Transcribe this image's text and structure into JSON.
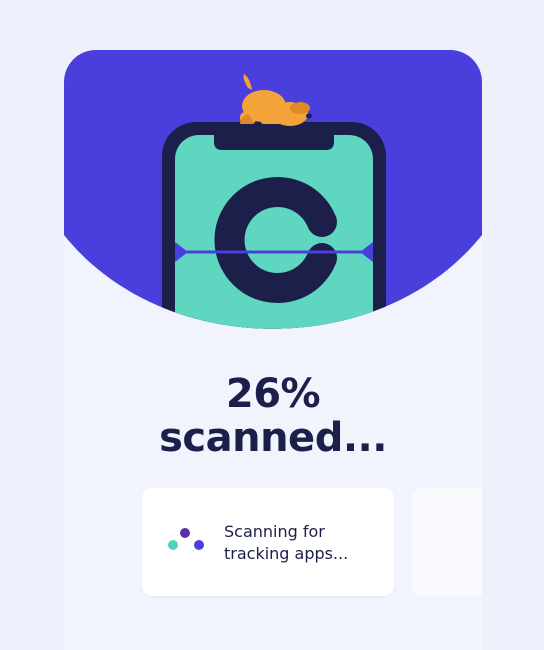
{
  "progress": {
    "percent_text": "26%",
    "status_text": "scanned...",
    "value_percent": 26
  },
  "step": {
    "label": "Scanning for tracking apps..."
  },
  "illustration": {
    "phone_logo": "C",
    "mascot": "dog-icon"
  },
  "colors": {
    "background": "#eef1fb",
    "hero": "#4a3fdd",
    "phone_frame": "#1b1f4a",
    "phone_screen": "#5fd6bf",
    "text": "#1b1f4a",
    "dog": "#f2a43a"
  }
}
